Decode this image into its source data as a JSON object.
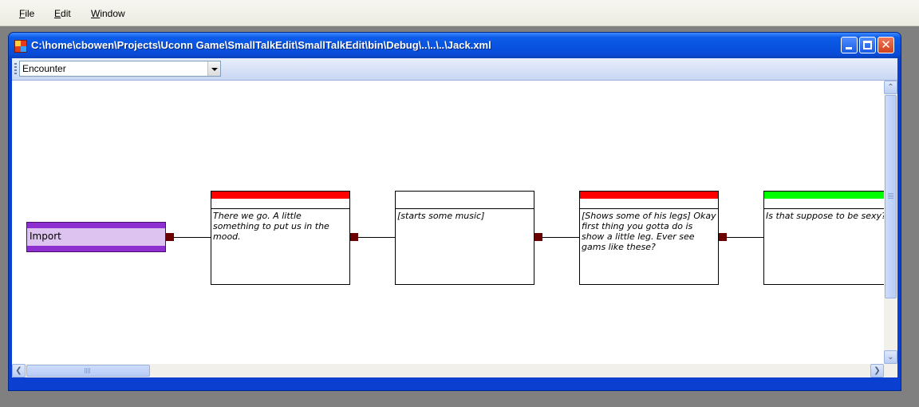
{
  "menu": {
    "items": [
      "File",
      "Edit",
      "Window"
    ],
    "mnemonics": [
      "F",
      "E",
      "W"
    ]
  },
  "window": {
    "title": "C:\\home\\cbowen\\Projects\\Uconn Game\\SmallTalkEdit\\SmallTalkEdit\\bin\\Debug\\..\\..\\..\\Jack.xml",
    "close_glyph": "✕"
  },
  "toolbar": {
    "dialog_select_value": "Encounter"
  },
  "graph": {
    "import_node": {
      "label": "Import",
      "color": "#8e2fd0"
    },
    "nodes": [
      {
        "text": " There we go. A little something to put us in the mood.",
        "header_color": "#ff0000"
      },
      {
        "text": "[starts some music]",
        "header_color": "#ffffff"
      },
      {
        "text": "[Shows some of his legs] Okay first thing you gotta do is show a little leg. Ever see gams like these?",
        "header_color": "#ff0000"
      },
      {
        "text": " Is that suppose to be sexy?",
        "header_color": "#00ff00"
      }
    ],
    "port_color": "#6b0000"
  },
  "scrollbars": {
    "up_glyph": "⌃",
    "down_glyph": "⌄",
    "left_glyph": "❮",
    "right_glyph": "❯"
  }
}
